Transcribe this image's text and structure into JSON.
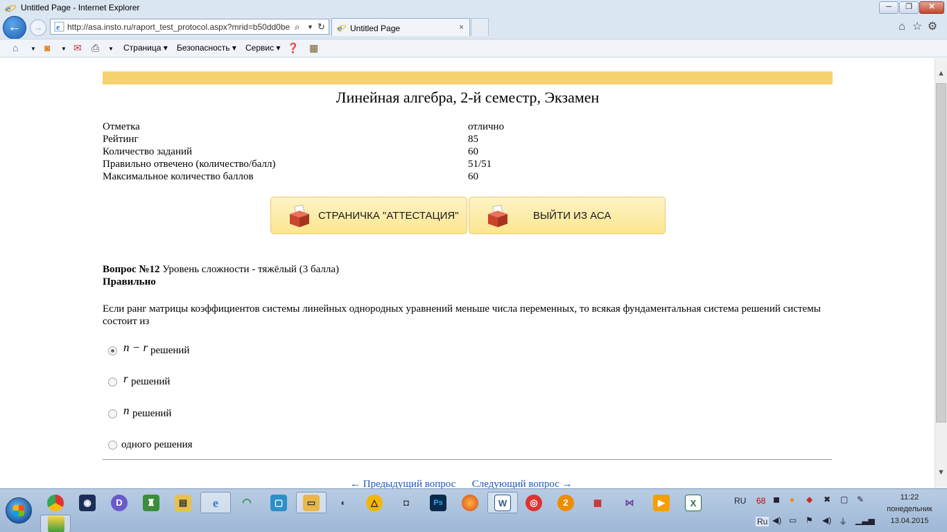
{
  "window": {
    "title": "Untitled Page - Internet Explorer",
    "minimize_glyph": "─",
    "maximize_glyph": "❐",
    "close_glyph": "✕"
  },
  "nav": {
    "url": "http://asa.insto.ru/raport_test_protocol.aspx?mrid=b50dd0be",
    "tab_title": "Untitled Page",
    "tab_close": "×"
  },
  "commandbar": {
    "page_menu": "Страница ▾",
    "safety_menu": "Безопасность ▾",
    "service_menu": "Сервис ▾"
  },
  "page": {
    "title": "Линейная алгебра, 2-й семестр, Экзамен",
    "stats": [
      {
        "label": "Отметка",
        "value": "отлично"
      },
      {
        "label": "Рейтинг",
        "value": "85"
      },
      {
        "label": "Количество заданий",
        "value": "60"
      },
      {
        "label": "Правильно отвечено (количество/балл)",
        "value": "51/51"
      },
      {
        "label": "Максимальное количество баллов",
        "value": "60"
      }
    ],
    "buttons": {
      "attestation": "СТРАНИЧКА \"АТТЕСТАЦИЯ\"",
      "exit": "ВЫЙТИ ИЗ АСА"
    },
    "question": {
      "number": "Вопрос №12",
      "difficulty": "Уровень сложности - тяжёлый (3 балла)",
      "status": "Правильно",
      "text": "Если ранг матрицы коэффициентов системы линейных однородных уравнений меньше числа переменных, то всякая фундаментальная система решений системы состоит из",
      "options": [
        {
          "math": "n − r",
          "word": "решений",
          "selected": true
        },
        {
          "math": "r",
          "word": "решений",
          "selected": false
        },
        {
          "math": "n",
          "word": "решений",
          "selected": false
        },
        {
          "math": "",
          "word": "одного решения",
          "selected": false
        }
      ]
    },
    "pager": {
      "prev": "← Предыдущий вопрос",
      "next": "Следующий вопрос →"
    }
  },
  "taskbar": {
    "lang": "RU",
    "lang2": "Ru",
    "tray_badge": "68",
    "time": "11:22",
    "weekday": "понедельник",
    "date": "13.04.2015"
  },
  "colors": {
    "accent_yellow": "#f7d36f",
    "link_blue": "#1a56c2",
    "button_yellow": "#fce68f"
  }
}
